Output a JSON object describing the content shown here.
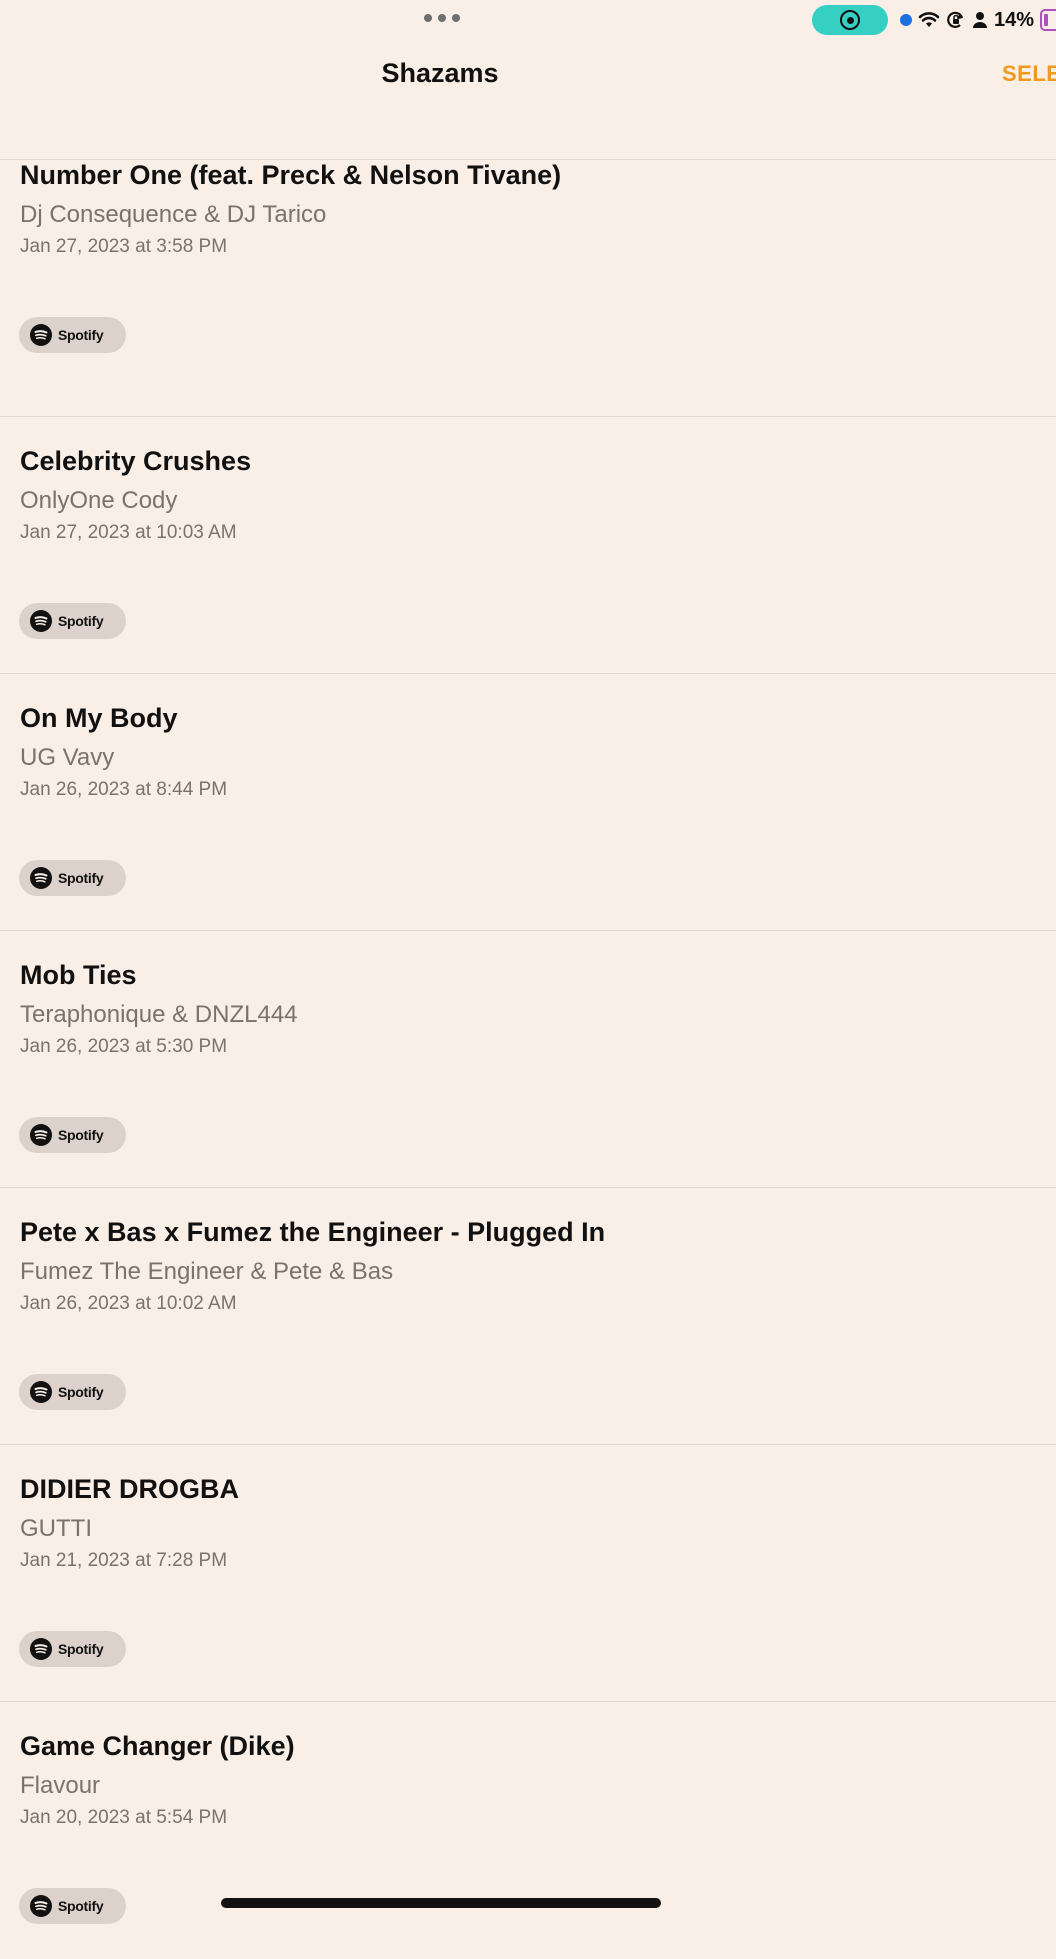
{
  "status_bar": {
    "battery_percent": "14%",
    "icons": [
      "screen-record-icon",
      "location-dot-icon",
      "wifi-icon",
      "orientation-lock-icon",
      "person-icon",
      "battery-icon"
    ],
    "accent_color": "#35d0c3",
    "battery_color": "#b04fc1"
  },
  "nav": {
    "title": "Shazams",
    "select_label": "SELE",
    "accent_color": "#ee9a1e"
  },
  "spotify_label": "Spotify",
  "items": [
    {
      "title": "Number One (feat. Preck & Nelson Tivane)",
      "artist": "Dj Consequence & DJ Tarico",
      "date": "Jan 27, 2023 at 3:58 PM"
    },
    {
      "title": "Celebrity Crushes",
      "artist": "OnlyOne Cody",
      "date": "Jan 27, 2023 at 10:03 AM"
    },
    {
      "title": "On My Body",
      "artist": "UG Vavy",
      "date": "Jan 26, 2023 at 8:44 PM"
    },
    {
      "title": "Mob Ties",
      "artist": "Teraphonique & DNZL444",
      "date": "Jan 26, 2023 at 5:30 PM"
    },
    {
      "title": "Pete x Bas x Fumez the Engineer - Plugged In",
      "artist": "Fumez The Engineer & Pete & Bas",
      "date": "Jan 26, 2023 at 10:02 AM"
    },
    {
      "title": "DIDIER DROGBA",
      "artist": "GUTTI",
      "date": "Jan 21, 2023 at 7:28 PM"
    },
    {
      "title": "Game Changer (Dike)",
      "artist": "Flavour",
      "date": "Jan 20, 2023 at 5:54 PM"
    }
  ]
}
